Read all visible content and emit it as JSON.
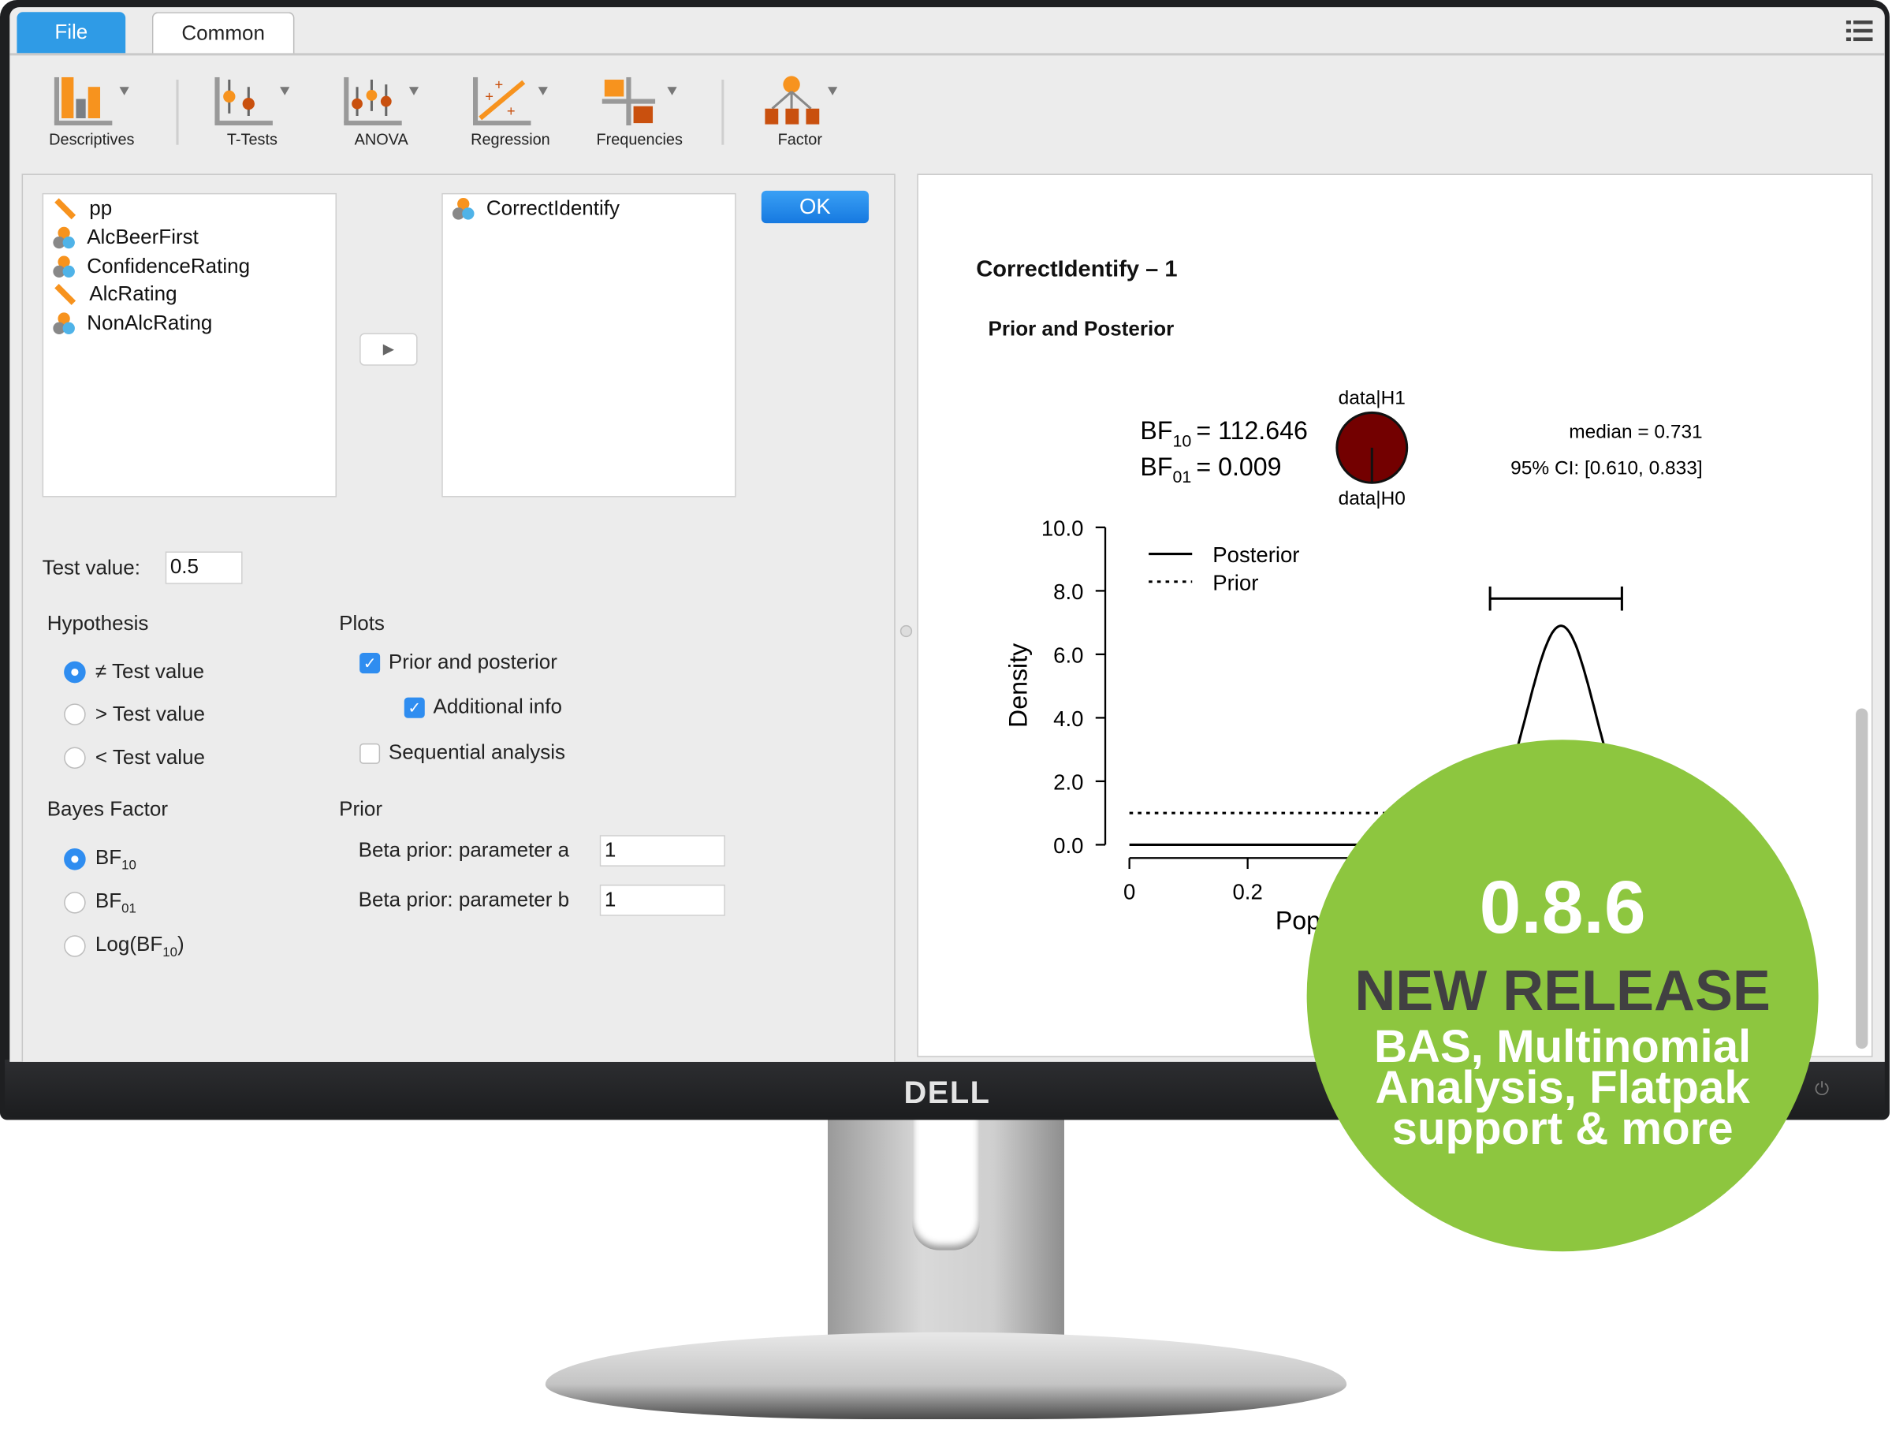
{
  "tabs": {
    "file": "File",
    "common": "Common"
  },
  "toolbar": [
    {
      "label": "Descriptives",
      "icon": "descriptives-icon"
    },
    {
      "label": "T-Tests",
      "icon": "t-tests-icon"
    },
    {
      "label": "ANOVA",
      "icon": "anova-icon"
    },
    {
      "label": "Regression",
      "icon": "regression-icon"
    },
    {
      "label": "Frequencies",
      "icon": "frequencies-icon"
    },
    {
      "label": "Factor",
      "icon": "factor-icon"
    }
  ],
  "variables": [
    {
      "name": "pp",
      "type": "scale"
    },
    {
      "name": "AlcBeerFirst",
      "type": "nominal"
    },
    {
      "name": "ConfidenceRating",
      "type": "nominal"
    },
    {
      "name": "AlcRating",
      "type": "scale"
    },
    {
      "name": "NonAlcRating",
      "type": "nominal"
    }
  ],
  "target_variables": [
    {
      "name": "CorrectIdentify",
      "type": "nominal"
    }
  ],
  "ok_label": "OK",
  "test_value": {
    "label": "Test value:",
    "value": "0.5"
  },
  "hypothesis": {
    "title": "Hypothesis",
    "options": [
      "≠ Test value",
      "> Test value",
      "< Test value"
    ],
    "selected": 0
  },
  "plots": {
    "title": "Plots",
    "prior_posterior": {
      "label": "Prior and posterior",
      "checked": true
    },
    "additional_info": {
      "label": "Additional info",
      "checked": true
    },
    "sequential": {
      "label": "Sequential analysis",
      "checked": false
    }
  },
  "bayes_factor": {
    "title": "Bayes Factor",
    "options": [
      {
        "base": "BF",
        "sub": "10"
      },
      {
        "base": "BF",
        "sub": "01"
      },
      {
        "base": "Log(BF",
        "sub": "10",
        "suffix": ")"
      }
    ],
    "selected": 0
  },
  "prior": {
    "title": "Prior",
    "a_label": "Beta prior: parameter a",
    "a_value": "1",
    "b_label": "Beta prior: parameter b",
    "b_value": "1"
  },
  "output": {
    "title": "CorrectIdentify – 1",
    "subtitle": "Prior and Posterior",
    "bf10": {
      "base": "BF",
      "sub": "10",
      "value": "= 112.646"
    },
    "bf01": {
      "base": "BF",
      "sub": "01",
      "value": "= 0.009"
    },
    "pie_top": "data|H1",
    "pie_bottom": "data|H0",
    "median": "median = 0.731",
    "ci": "95% CI: [0.610, 0.833]"
  },
  "chart_data": {
    "type": "line",
    "ylabel": "Density",
    "xlabel": "Pop",
    "ylim": [
      0,
      10
    ],
    "yticks": [
      "0.0",
      "2.0",
      "4.0",
      "6.0",
      "8.0",
      "10.0"
    ],
    "xlim": [
      0,
      1
    ],
    "xticks": [
      "0",
      "0.2"
    ],
    "legend": {
      "position": "top-left",
      "entries": [
        "Posterior",
        "Prior"
      ]
    },
    "series": [
      {
        "name": "Posterior",
        "style": "solid",
        "mode": 0.73,
        "peak_density": 6.9
      },
      {
        "name": "Prior",
        "style": "dotted",
        "density": 1.0
      }
    ],
    "credible_interval": [
      0.61,
      0.833
    ],
    "pie": {
      "data|H1": 112.646,
      "data|H0": 1,
      "color": "#730000"
    }
  },
  "badge": {
    "version": "0.8.6",
    "headline": "NEW RELEASE",
    "lines": [
      "BAS, Multinomial",
      "Analysis, Flatpak",
      "support & more"
    ],
    "color": "#8dc63f",
    "headline_color": "#414042"
  },
  "brand": "DELL"
}
